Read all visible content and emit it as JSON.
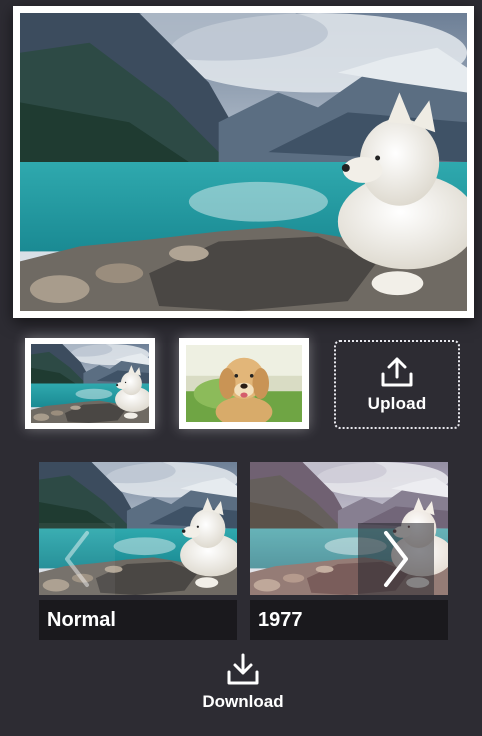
{
  "upload": {
    "label": "Upload",
    "icon": "upload-icon"
  },
  "thumbnails": [
    {
      "subject": "lake-landscape-with-white-dog",
      "selected": true
    },
    {
      "subject": "golden-retriever-in-grass",
      "selected": false
    }
  ],
  "filters": [
    {
      "label": "Normal"
    },
    {
      "label": "1977"
    }
  ],
  "carousel": {
    "prev_icon": "chevron-left-icon",
    "next_icon": "chevron-right-icon"
  },
  "download": {
    "label": "Download",
    "icon": "download-icon"
  },
  "colors": {
    "background": "#2d2c33",
    "caption_bg": "#1a191d",
    "frame": "#ffffff"
  }
}
